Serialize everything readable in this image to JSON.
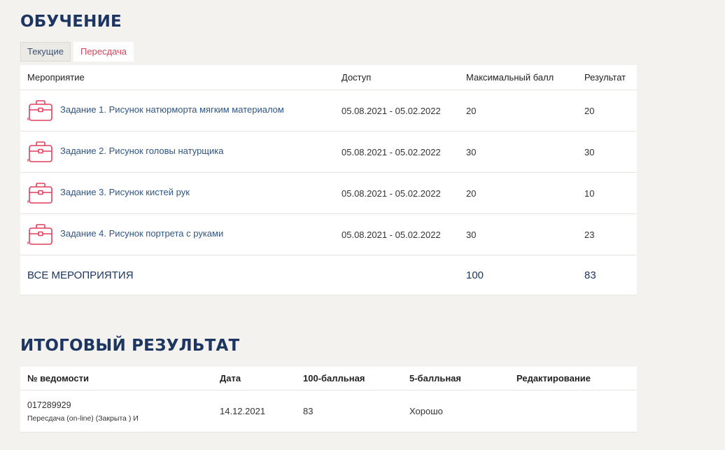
{
  "learning": {
    "title": "ОБУЧЕНИЕ",
    "tabs": [
      {
        "label": "Текущие",
        "active": true
      },
      {
        "label": "Пересдача",
        "active": false
      }
    ],
    "columns": {
      "event": "Мероприятие",
      "access": "Доступ",
      "max_score": "Максимальный балл",
      "result": "Результат"
    },
    "events": [
      {
        "name": "Задание 1. Рисунок натюрморта мягким материалом",
        "access": "05.08.2021 - 05.02.2022",
        "max_score": "20",
        "result": "20",
        "icon": "briefcase-icon"
      },
      {
        "name": "Задание 2. Рисунок головы натурщика",
        "access": "05.08.2021 - 05.02.2022",
        "max_score": "30",
        "result": "30",
        "icon": "briefcase-icon"
      },
      {
        "name": "Задание 3. Рисунок кистей рук",
        "access": "05.08.2021 - 05.02.2022",
        "max_score": "20",
        "result": "10",
        "icon": "briefcase-icon"
      },
      {
        "name": "Задание 4. Рисунок портрета с руками",
        "access": "05.08.2021 - 05.02.2022",
        "max_score": "30",
        "result": "23",
        "icon": "briefcase-icon"
      }
    ],
    "total": {
      "label": "ВСЕ МЕРОПРИЯТИЯ",
      "max_score": "100",
      "result": "83"
    }
  },
  "final": {
    "title": "ИТОГОВЫЙ РЕЗУЛЬТАТ",
    "columns": {
      "number": "№ ведомости",
      "date": "Дата",
      "score100": "100-балльная",
      "score5": "5-балльная",
      "edit": "Редактирование"
    },
    "rows": [
      {
        "number": "017289929",
        "subtitle": "Пересдача (on-line) (Закрыта ) И",
        "date": "14.12.2021",
        "score100": "83",
        "score5": "Хорошо",
        "edit": ""
      }
    ]
  },
  "colors": {
    "heading": "#1c3561",
    "link": "#2f5684",
    "accent": "#d0455a",
    "background": "#f3f2ef"
  }
}
